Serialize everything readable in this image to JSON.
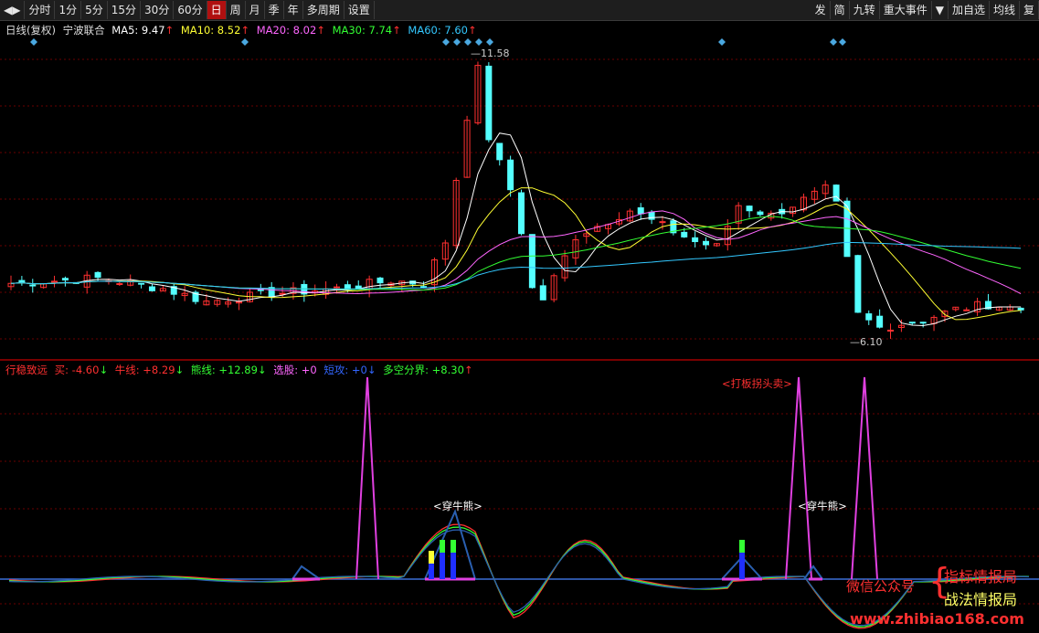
{
  "toolbar": {
    "left_items": [
      {
        "label": "◀▶",
        "active": false
      },
      {
        "label": "分时",
        "active": false
      },
      {
        "label": "1分",
        "active": false
      },
      {
        "label": "5分",
        "active": false
      },
      {
        "label": "15分",
        "active": false
      },
      {
        "label": "30分",
        "active": false
      },
      {
        "label": "60分",
        "active": false
      },
      {
        "label": "日",
        "active": true
      },
      {
        "label": "周",
        "active": false
      },
      {
        "label": "月",
        "active": false
      },
      {
        "label": "季",
        "active": false
      },
      {
        "label": "年",
        "active": false
      },
      {
        "label": "多周期",
        "active": false
      },
      {
        "label": "设置",
        "active": false
      }
    ],
    "right_items": [
      {
        "label": "发"
      },
      {
        "label": "简"
      },
      {
        "label": "九转"
      },
      {
        "label": "重大事件"
      },
      {
        "label": "▼"
      },
      {
        "label": "加自选"
      },
      {
        "label": "均线"
      },
      {
        "label": "复"
      }
    ]
  },
  "main_legend": {
    "period": "日线(复权)",
    "stock": "宁波联合",
    "ma5": "MA5: 9.47",
    "ma10": "MA10: 8.52",
    "ma20": "MA20: 8.02",
    "ma30": "MA30: 7.74",
    "ma60": "MA60: 7.60",
    "up_arrow": "↑",
    "down_arrow": "↓"
  },
  "price_labels": {
    "high": "11.58",
    "low": "6.10"
  },
  "sub_legend": {
    "name": "行稳致远",
    "buy": "买: -4.60",
    "niu": "牛线: +8.29",
    "xiong": "熊线: +12.89",
    "xuangu": "选股: +0",
    "duangong": "短攻: +0",
    "duokong": "多空分界: +8.30",
    "up": "↑",
    "down": "↓"
  },
  "sub_annotations": {
    "dabanzhuaitou": "<打板拐头卖>",
    "chuanniuxiong_1": "<穿牛熊>",
    "chuanniuxiong_2": "<穿牛熊>"
  },
  "watermark": {
    "wechat": "微信公众号",
    "brand1": "指标情报局",
    "brand2": "战法情报局",
    "url": "www.zhibiao168.com"
  },
  "colors": {
    "up": "#ff3030",
    "down": "#54ffff",
    "ma5": "#ffffff",
    "ma10": "#ffff33",
    "ma20": "#ff66ff",
    "ma30": "#33ff33",
    "ma60": "#33c8ff",
    "magenta": "#e040e0",
    "grid": "#6a0000"
  }
}
